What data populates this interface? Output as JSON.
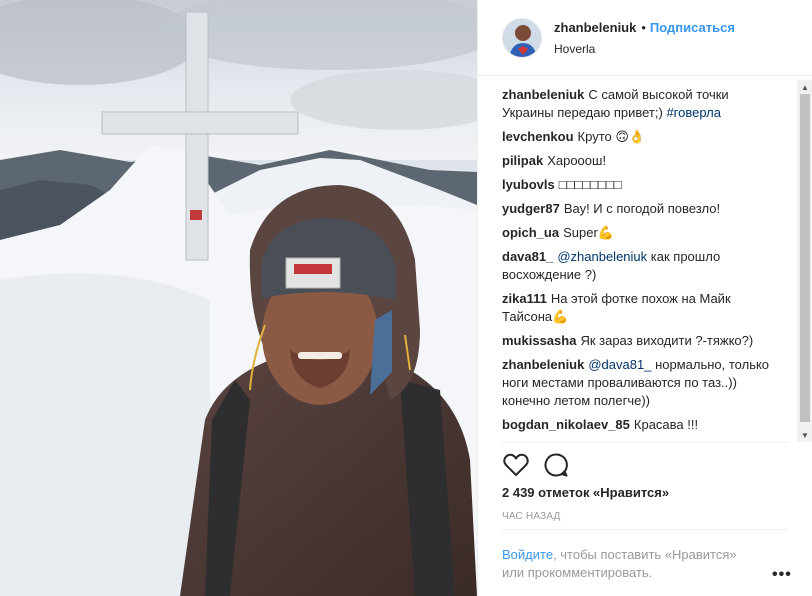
{
  "header": {
    "username": "zhanbeleniuk",
    "separator": "•",
    "follow_label": "Подписаться",
    "location": "Hoverla"
  },
  "comments": [
    {
      "author": "zhanbeleniuk",
      "text": "С самой высокой точки Украины передаю привет;)",
      "hashtag": "#говерла"
    },
    {
      "author": "levchenkou",
      "text": "Круто 🙃👌"
    },
    {
      "author": "pilipak",
      "text": "Харооош!"
    },
    {
      "author": "lyubovls",
      "text": "□□□□□□□□"
    },
    {
      "author": "yudger87",
      "text": "Вау! И с погодой повезло!"
    },
    {
      "author": "opich_ua",
      "text": "Super💪"
    },
    {
      "author": "dava81_",
      "mention": "@zhanbeleniuk",
      "text": "как прошло восхождение ?)"
    },
    {
      "author": "zika111",
      "text": "На этой фотке похож на Майк Тайсона💪"
    },
    {
      "author": "mukissasha",
      "text": "Як зараз виходити ?-тяжко?)"
    },
    {
      "author": "zhanbeleniuk",
      "mention": "@dava81_",
      "text": "нормально, только ноги местами проваливаются по таз..)) конечно летом полегче))"
    },
    {
      "author": "bogdan_nikolaev_85",
      "text": "Красава !!!"
    }
  ],
  "likes": "2 439 отметок «Нравится»",
  "time": "ЧАС НАЗАД",
  "login": {
    "link": "Войдите",
    "rest": ", чтобы поставить «Нравится» или прокомментировать."
  },
  "more_label": "•••",
  "icons": {
    "like": "heart-icon",
    "comment": "comment-icon",
    "more": "more-options-icon"
  },
  "colors": {
    "link": "#3897f0",
    "hashtag": "#003569",
    "text": "#262626",
    "muted": "#999999"
  }
}
